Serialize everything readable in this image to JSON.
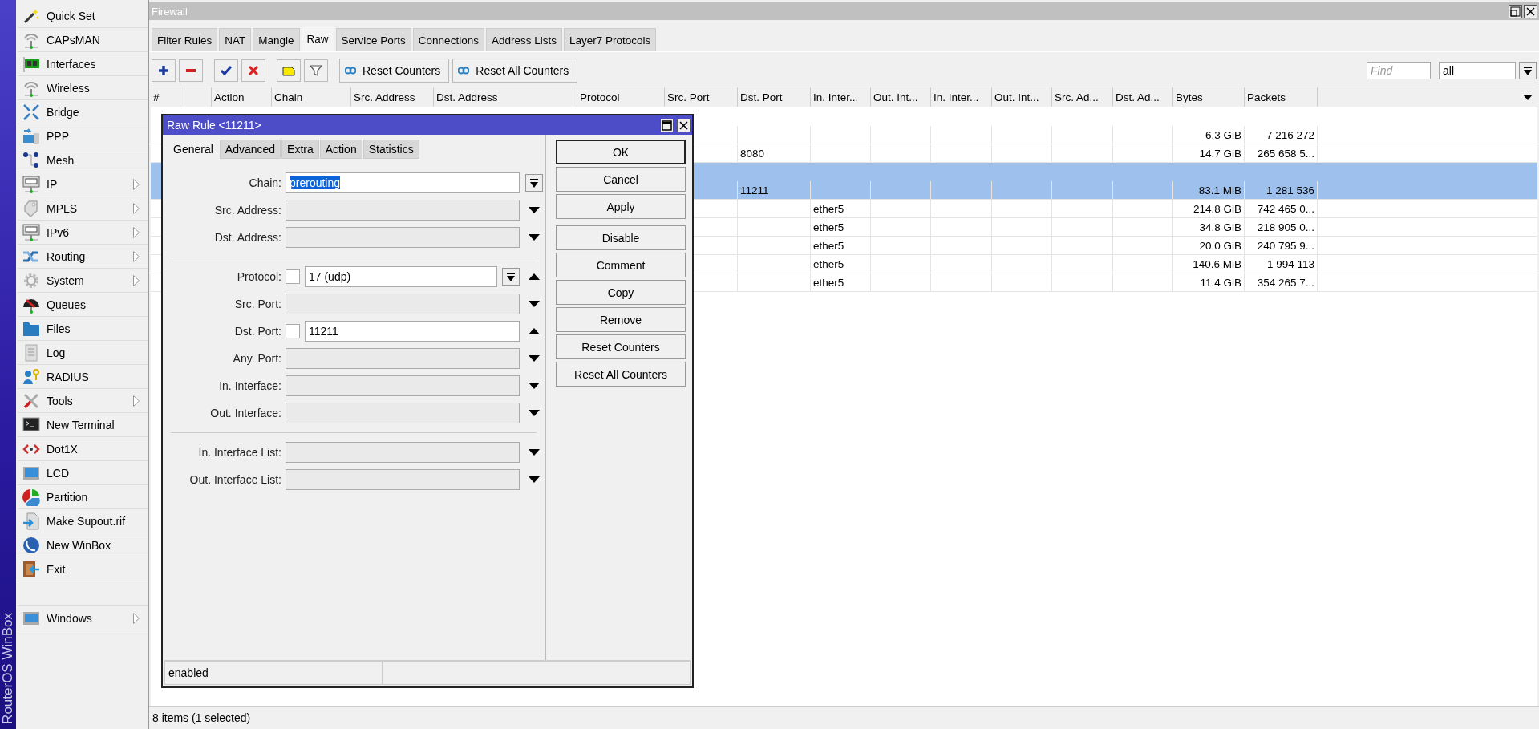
{
  "sidebar": {
    "brand": "RouterOS WinBox",
    "items": [
      {
        "label": "Quick Set",
        "submenu": false
      },
      {
        "label": "CAPsMAN",
        "submenu": false
      },
      {
        "label": "Interfaces",
        "submenu": false
      },
      {
        "label": "Wireless",
        "submenu": false
      },
      {
        "label": "Bridge",
        "submenu": false
      },
      {
        "label": "PPP",
        "submenu": false
      },
      {
        "label": "Mesh",
        "submenu": false
      },
      {
        "label": "IP",
        "submenu": true
      },
      {
        "label": "MPLS",
        "submenu": true
      },
      {
        "label": "IPv6",
        "submenu": true
      },
      {
        "label": "Routing",
        "submenu": true
      },
      {
        "label": "System",
        "submenu": true
      },
      {
        "label": "Queues",
        "submenu": false
      },
      {
        "label": "Files",
        "submenu": false
      },
      {
        "label": "Log",
        "submenu": false
      },
      {
        "label": "RADIUS",
        "submenu": false
      },
      {
        "label": "Tools",
        "submenu": true
      },
      {
        "label": "New Terminal",
        "submenu": false
      },
      {
        "label": "Dot1X",
        "submenu": false
      },
      {
        "label": "LCD",
        "submenu": false
      },
      {
        "label": "Partition",
        "submenu": false
      },
      {
        "label": "Make Supout.rif",
        "submenu": false
      },
      {
        "label": "New WinBox",
        "submenu": false
      },
      {
        "label": "Exit",
        "submenu": false
      }
    ],
    "bottom_items": [
      {
        "label": "Windows",
        "submenu": true
      }
    ]
  },
  "window": {
    "title": "Firewall",
    "tabs": [
      {
        "label": "Filter Rules",
        "selected": false
      },
      {
        "label": "NAT",
        "selected": false
      },
      {
        "label": "Mangle",
        "selected": false
      },
      {
        "label": "Raw",
        "selected": true
      },
      {
        "label": "Service Ports",
        "selected": false
      },
      {
        "label": "Connections",
        "selected": false
      },
      {
        "label": "Address Lists",
        "selected": false
      },
      {
        "label": "Layer7 Protocols",
        "selected": false
      }
    ],
    "toolbar": {
      "buttons": [
        "Reset Counters",
        "Reset All Counters"
      ],
      "find_placeholder": "Find",
      "filter_value": "all"
    },
    "table": {
      "columns": [
        {
          "label": "#"
        },
        {},
        {
          "label": "Action"
        },
        {
          "label": "Chain"
        },
        {
          "label": "Src. Address"
        },
        {
          "label": "Dst. Address"
        },
        {
          "label": "Protocol"
        },
        {
          "label": "Src. Port"
        },
        {
          "label": "Dst. Port"
        },
        {
          "label": "In. Inter..."
        },
        {
          "label": "Out. Int..."
        },
        {
          "label": "In. Inter..."
        },
        {
          "label": "Out. Int..."
        },
        {
          "label": "Src. Ad..."
        },
        {
          "label": "Dst. Ad..."
        },
        {
          "label": "Bytes"
        },
        {
          "label": "Packets"
        }
      ],
      "rows": [
        {
          "kind": "comment",
          "selected": false
        },
        {
          "kind": "rule",
          "selected": false,
          "bytes": "6.3 GiB",
          "packets": "7 216 272"
        },
        {
          "kind": "rule",
          "selected": false,
          "dst_port": "8080",
          "bytes": "14.7 GiB",
          "packets": "265 658 5..."
        },
        {
          "kind": "comment",
          "selected": true
        },
        {
          "kind": "rule",
          "selected": true,
          "dst_port": "11211",
          "bytes": "83.1 MiB",
          "packets": "1 281 536"
        },
        {
          "kind": "rule",
          "selected": false,
          "in_interface": "ether5",
          "bytes": "214.8 GiB",
          "packets": "742 465 0..."
        },
        {
          "kind": "rule",
          "selected": false,
          "in_interface": "ether5",
          "bytes": "34.8 GiB",
          "packets": "218 905 0..."
        },
        {
          "kind": "rule",
          "selected": false,
          "in_interface": "ether5",
          "bytes": "20.0 GiB",
          "packets": "240 795 9..."
        },
        {
          "kind": "rule",
          "selected": false,
          "in_interface": "ether5",
          "bytes": "140.6 MiB",
          "packets": "1 994 113"
        },
        {
          "kind": "rule",
          "selected": false,
          "in_interface": "ether5",
          "bytes": "11.4 GiB",
          "packets": "354 265 7..."
        }
      ]
    },
    "status_bar": "8 items (1 selected)"
  },
  "dialog": {
    "title": "Raw Rule <11211>",
    "tabs": [
      {
        "label": "General",
        "selected": true
      },
      {
        "label": "Advanced",
        "selected": false
      },
      {
        "label": "Extra",
        "selected": false
      },
      {
        "label": "Action",
        "selected": false
      },
      {
        "label": "Statistics",
        "selected": false
      }
    ],
    "sections": [
      [
        {
          "label": "Chain:",
          "kind": "select",
          "value": "prerouting",
          "highlighted": true
        },
        {
          "label": "Src. Address:",
          "kind": "empty"
        },
        {
          "label": "Dst. Address:",
          "kind": "empty"
        }
      ],
      [
        {
          "label": "Protocol:",
          "kind": "negatable",
          "negated": false,
          "value": "17 (udp)",
          "dropdown": true
        },
        {
          "label": "Src. Port:",
          "kind": "empty"
        },
        {
          "label": "Dst. Port:",
          "kind": "negatable",
          "negated": false,
          "value": "11211",
          "dropdown": false
        },
        {
          "label": "Any. Port:",
          "kind": "empty"
        },
        {
          "label": "In. Interface:",
          "kind": "empty"
        },
        {
          "label": "Out. Interface:",
          "kind": "empty"
        }
      ],
      [
        {
          "label": "In. Interface List:",
          "kind": "empty"
        },
        {
          "label": "Out. Interface List:",
          "kind": "empty"
        }
      ]
    ],
    "button_groups": [
      [
        {
          "label": "OK",
          "default": true
        },
        {
          "label": "Cancel",
          "default": false
        },
        {
          "label": "Apply",
          "default": false
        }
      ],
      [
        {
          "label": "Disable",
          "default": false
        },
        {
          "label": "Comment",
          "default": false
        },
        {
          "label": "Copy",
          "default": false
        },
        {
          "label": "Remove",
          "default": false
        },
        {
          "label": "Reset Counters",
          "default": false
        },
        {
          "label": "Reset All Counters",
          "default": false
        }
      ]
    ],
    "status": "enabled"
  }
}
